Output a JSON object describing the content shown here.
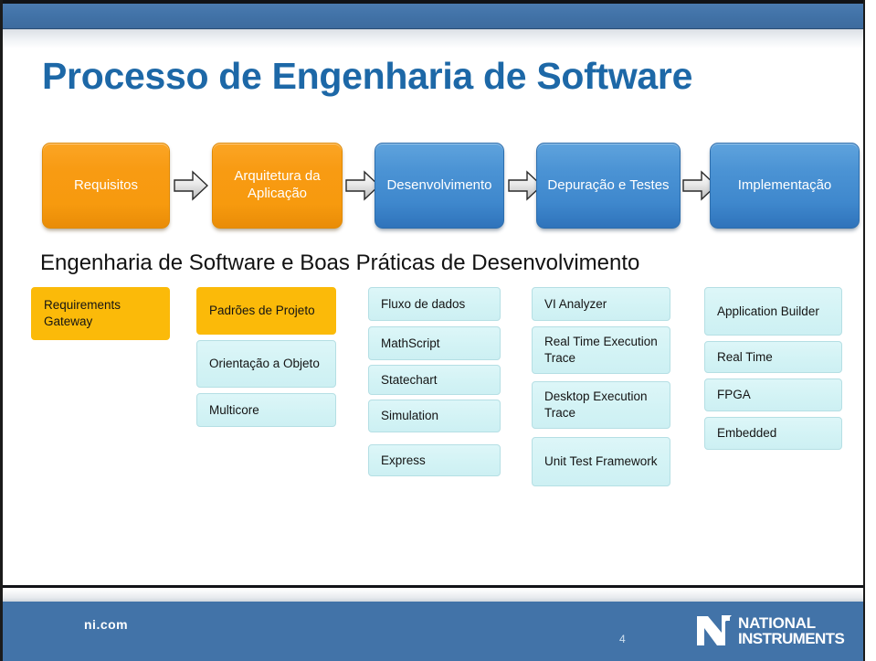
{
  "title": "Processo de Engenharia de Software",
  "subtitle": "Engenharia de Software e Boas Práticas de Desenvolvimento",
  "colors": {
    "title_blue": "#1d68a7",
    "band_blue": "#4273a8",
    "orange": "#f89b13",
    "blue_box": "#4b93d4",
    "amber_chip": "#fbba09",
    "cyan_chip": "#d3f3f5"
  },
  "flow": {
    "steps": [
      {
        "label": "Requisitos",
        "style": "orange"
      },
      {
        "label": "Arquitetura da Aplicação",
        "style": "orange"
      },
      {
        "label": "Desenvolvimento",
        "style": "blue"
      },
      {
        "label": "Depuração e Testes",
        "style": "blue"
      },
      {
        "label": "Implementação",
        "style": "blue"
      }
    ],
    "arrow_icon": "right-block-arrow-icon",
    "arrow_count": 4
  },
  "columns": [
    {
      "name": "requirements",
      "chips": [
        {
          "label": "Requirements Gateway",
          "style": "amber"
        }
      ]
    },
    {
      "name": "architecture",
      "chips": [
        {
          "label": "Padrões de Projeto",
          "style": "amber"
        },
        {
          "label": "Orientação a Objeto",
          "style": "cyan"
        },
        {
          "label": "Multicore",
          "style": "cyan"
        }
      ]
    },
    {
      "name": "development",
      "chips": [
        {
          "label": "Fluxo de dados",
          "style": "cyan"
        },
        {
          "label": "MathScript",
          "style": "cyan"
        },
        {
          "label": "Statechart",
          "style": "cyan"
        },
        {
          "label": "Simulation",
          "style": "cyan"
        },
        {
          "label": "Express",
          "style": "cyan"
        }
      ]
    },
    {
      "name": "debug-test",
      "chips": [
        {
          "label": "VI Analyzer",
          "style": "cyan"
        },
        {
          "label": "Real Time Execution Trace",
          "style": "cyan"
        },
        {
          "label": "Desktop Execution Trace",
          "style": "cyan"
        },
        {
          "label": "Unit Test Framework",
          "style": "cyan"
        }
      ]
    },
    {
      "name": "deployment",
      "chips": [
        {
          "label": "Application Builder",
          "style": "cyan"
        },
        {
          "label": "Real Time",
          "style": "cyan"
        },
        {
          "label": "FPGA",
          "style": "cyan"
        },
        {
          "label": "Embedded",
          "style": "cyan"
        }
      ]
    }
  ],
  "footer": {
    "domain": "ni.com",
    "page_number": "4",
    "logo_mark_icon": "national-instruments-eagle-icon",
    "logo_line1": "NATIONAL",
    "logo_line2": "INSTRUMENTS",
    "logo_tm": "™"
  },
  "watermark": ""
}
